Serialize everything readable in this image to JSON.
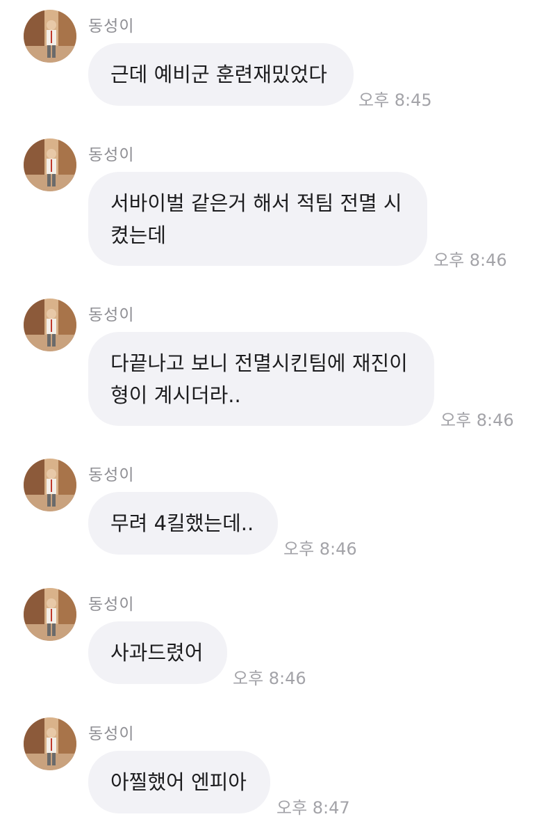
{
  "messages": [
    {
      "sender": "동성이",
      "text": "근데 예비군 훈련재밌었다",
      "time": "오후 8:45"
    },
    {
      "sender": "동성이",
      "text": "서바이벌 같은거 해서 적팀 전멸 시\n켰는데",
      "time": "오후 8:46"
    },
    {
      "sender": "동성이",
      "text": "다끝나고 보니 전멸시킨팀에 재진이\n형이 계시더라..",
      "time": "오후 8:46"
    },
    {
      "sender": "동성이",
      "text": "무려 4킬했는데..",
      "time": "오후 8:46"
    },
    {
      "sender": "동성이",
      "text": "사과드렸어",
      "time": "오후 8:46"
    },
    {
      "sender": "동성이",
      "text": "아찔했어 엔피아",
      "time": "오후 8:47"
    }
  ]
}
